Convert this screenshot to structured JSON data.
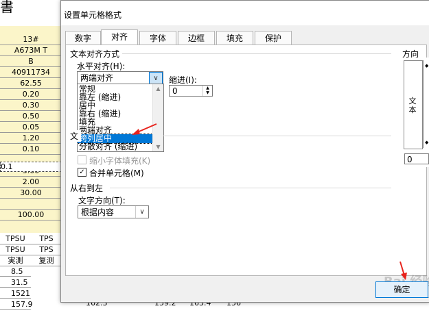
{
  "sheet": {
    "title_char": "書",
    "col_a_values": [
      "13#",
      "A673M T",
      "B",
      "40911734",
      "62.55",
      "0.20",
      "0.30",
      "0.50",
      "0.05",
      "1.20",
      "0.10",
      "0.1",
      "3.00",
      "2.00",
      "30.00",
      "",
      "100.00"
    ],
    "header_rows": [
      [
        "TPSU",
        "TPS"
      ],
      [
        "TPSU",
        "TPS"
      ],
      [
        "実測",
        "复测"
      ]
    ],
    "bottom_values": [
      "8.5",
      "31.5",
      "1521",
      "157.9"
    ],
    "bottom_row_cells": [
      "162.3",
      "159.2",
      "163.4",
      "156"
    ]
  },
  "dialog": {
    "title": "设置单元格格式",
    "tabs": [
      "数字",
      "对齐",
      "字体",
      "边框",
      "填充",
      "保护"
    ],
    "active_tab": "对齐",
    "text_alignment": {
      "group_label": "文本对齐方式",
      "horizontal_label": "水平对齐(H):",
      "horizontal_value": "两端对齐",
      "indent_label": "缩进(I):",
      "indent_value": "0",
      "options": [
        "常规",
        "靠左 (缩进)",
        "居中",
        "靠右 (缩进)",
        "填充",
        "两端对齐",
        "跨列居中",
        "分散对齐 (缩进)"
      ],
      "selected_option": "跨列居中"
    },
    "text_control": {
      "group_label_partial": "文",
      "shrink_to_fit_label": "缩小字体填充(K)",
      "shrink_to_fit_checked": false,
      "merge_cells_label": "合并单元格(M)",
      "merge_cells_checked": true
    },
    "rtl": {
      "group_label": "从右到左",
      "direction_label": "文字方向(T):",
      "direction_value": "根据内容"
    },
    "orientation": {
      "label": "方向",
      "vertical_text": [
        "文",
        "本"
      ],
      "degrees_value": "0"
    },
    "ok_label": "确定"
  },
  "colors": {
    "accent": "#0078d7",
    "arrow_red": "#e8231c",
    "sheet_fill": "#fbf5c9"
  }
}
